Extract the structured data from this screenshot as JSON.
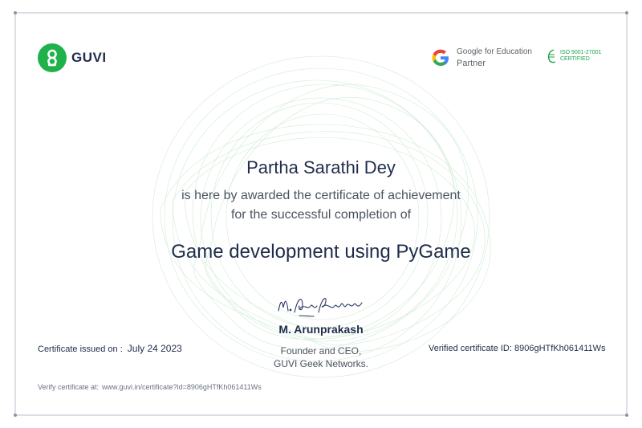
{
  "brand": {
    "name": "GUVI",
    "accent": "#1fb24a",
    "text_color": "#1f2d4a"
  },
  "google_partner": {
    "line1": "Google for Education",
    "line2": "Partner"
  },
  "iso": {
    "line1": "ISO 9001-27001",
    "line2": "CERTIFIED",
    "color": "#1aa34a"
  },
  "recipient": {
    "name": "Partha Sarathi Dey"
  },
  "award": {
    "line1": "is here by awarded the certificate of achievement",
    "line2": "for the successful completion of"
  },
  "course": {
    "title": "Game development using PyGame"
  },
  "signatory": {
    "name": "M. Arunprakash",
    "role_line1": "Founder and CEO,",
    "role_line2": "GUVI Geek Networks."
  },
  "issued": {
    "label": "Certificate issued on :",
    "date": "July 24 2023"
  },
  "verified": {
    "label": "Verified certificate ID:",
    "id": "8906gHTfKh061411Ws"
  },
  "verify": {
    "label": "Verify certificate at:",
    "url": "www.guvi.in/certificate?id=8906gHTfKh061411Ws"
  }
}
